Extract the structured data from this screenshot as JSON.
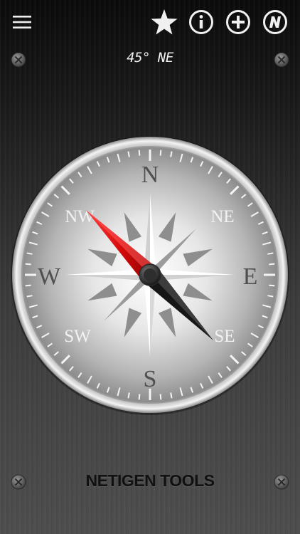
{
  "header": {
    "menu_icon": "hamburger-menu-icon",
    "favorite_icon": "star-icon",
    "info_icon": "info-icon",
    "add_icon": "plus-circle-icon",
    "brand_icon": "netigen-logo-icon"
  },
  "heading": {
    "text": "45° NE"
  },
  "compass": {
    "cardinals": {
      "n": "N",
      "e": "E",
      "s": "S",
      "w": "W"
    },
    "intercardinals": {
      "ne": "NE",
      "se": "SE",
      "sw": "SW",
      "nw": "NW"
    },
    "needle_colors": {
      "north": "#d40a0a",
      "south": "#141414"
    }
  },
  "footer": {
    "brand": "NETIGEN TOOLS"
  }
}
